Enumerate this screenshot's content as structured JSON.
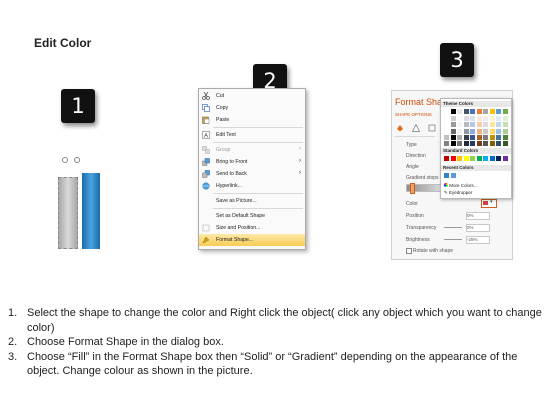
{
  "title": "Edit Color",
  "badges": [
    "1",
    "2",
    "3"
  ],
  "colors": {
    "badge_bg": "#111111",
    "bar_gray": "#b9b9b9",
    "bar_blue": "#2e86c8",
    "panel_accent": "#d04a02",
    "menu_highlight": "#f8cc55"
  },
  "menu": {
    "items": [
      {
        "label": "Cut",
        "icon": "scissors-icon",
        "underline": "t"
      },
      {
        "label": "Copy",
        "icon": "copy-icon"
      },
      {
        "label": "Paste",
        "icon": "paste-icon"
      },
      {
        "label": "Edit Text",
        "icon": "edit-text-icon"
      },
      {
        "label": "Group",
        "icon": "group-icon",
        "disabled": true,
        "submenu": true
      },
      {
        "label": "Bring to Front",
        "icon": "bring-to-front-icon",
        "submenu": true
      },
      {
        "label": "Send to Back",
        "icon": "send-to-back-icon",
        "submenu": true
      },
      {
        "label": "Hyperlink...",
        "icon": "hyperlink-icon"
      },
      {
        "label": "Save as Picture...",
        "icon": ""
      },
      {
        "label": "Set as Default Shape",
        "icon": ""
      },
      {
        "label": "Size and Position...",
        "icon": "size-position-icon"
      },
      {
        "label": "Format Shape...",
        "icon": "format-shape-icon",
        "highlighted": true
      }
    ]
  },
  "format_panel": {
    "title": "Format Shape",
    "shape_options": "SHAPE OPTIONS",
    "rows": [
      "Type",
      "Direction",
      "Angle",
      "Gradient stops",
      "Color",
      "Position",
      "Transparency",
      "Brightness"
    ],
    "values": {
      "position": "0%",
      "transparency": "0%",
      "brightness": "-25%"
    },
    "rotate_with_shape": "Rotate with shape"
  },
  "color_popup": {
    "theme_colors": "Theme Colors",
    "standard_colors": "Standard Colors",
    "recent_colors": "Recent Colors",
    "more_colors": "More Colors...",
    "eyedropper": "Eyedropper",
    "theme_columns": [
      "#ffffff",
      "#000000",
      "#e7e6e6",
      "#44546a",
      "#4472c4",
      "#ed7d31",
      "#a5a5a5",
      "#ffc000",
      "#5b9bd5",
      "#70ad47"
    ],
    "standard": [
      "#c00000",
      "#ff0000",
      "#ffc000",
      "#ffff00",
      "#92d050",
      "#00b050",
      "#00b0f0",
      "#0070c0",
      "#002060",
      "#7030a0"
    ],
    "recent": [
      "#2e86c8",
      "#5b9bd5"
    ]
  },
  "instructions": [
    {
      "num": "1.",
      "text": "Select the shape to change the color and Right click the object( click any object which you want to change color)"
    },
    {
      "num": "2.",
      "text": "Choose Format Shape in the dialog box."
    },
    {
      "num": "3.",
      "text": "Choose “Fill” in the Format Shape box then “Solid” or “Gradient” depending on the appearance of the object. Change colour as shown in the picture."
    }
  ]
}
